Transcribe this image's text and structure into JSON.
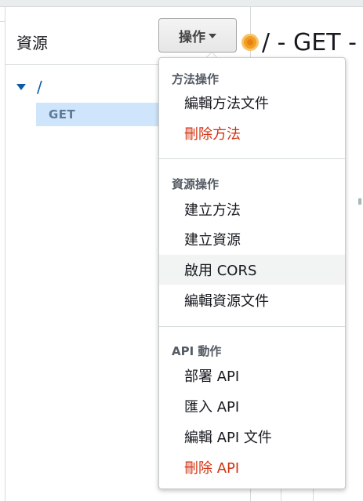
{
  "resources_panel": {
    "title": "資源",
    "actions_button_label": "操作",
    "tree": {
      "root_label": "/",
      "method_label": "GET"
    }
  },
  "main": {
    "title": "/ - GET - 方"
  },
  "actions_menu": {
    "groups": [
      {
        "header": "方法操作",
        "items": [
          {
            "label": "編輯方法文件"
          },
          {
            "label": "刪除方法"
          }
        ]
      },
      {
        "header": "資源操作",
        "items": [
          {
            "label": "建立方法"
          },
          {
            "label": "建立資源"
          },
          {
            "label": "啟用 CORS"
          },
          {
            "label": "編輯資源文件"
          }
        ]
      },
      {
        "header": "API 動作",
        "items": [
          {
            "label": "部署 API"
          },
          {
            "label": "匯入 API"
          },
          {
            "label": "編輯 API 文件"
          },
          {
            "label": "刪除 API"
          }
        ]
      }
    ]
  },
  "colors": {
    "danger": "#d13212",
    "tree_link": "#0a5aa8",
    "selected_row": "#cfe5fb",
    "hover_row": "#f2f3f3"
  }
}
